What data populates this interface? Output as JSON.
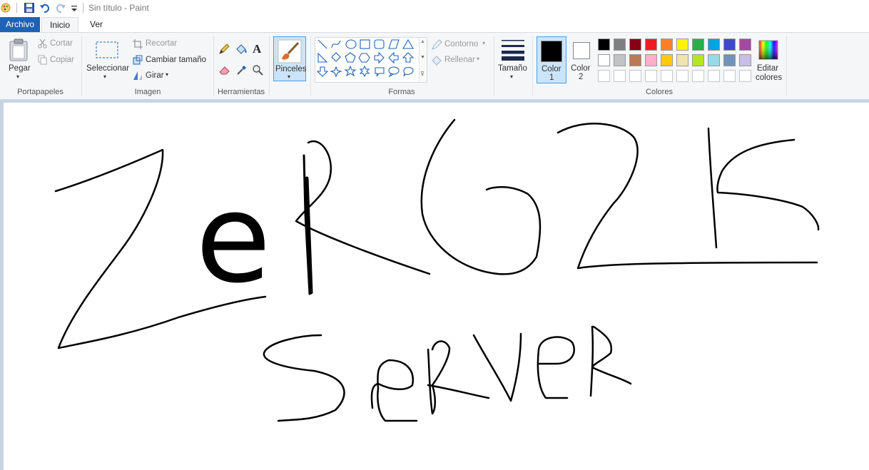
{
  "window": {
    "title": "Sin título - Paint"
  },
  "tabs": [
    {
      "label": "Archivo"
    },
    {
      "label": "Inicio"
    },
    {
      "label": "Ver"
    }
  ],
  "clipboard": {
    "paste": "Pegar",
    "cut": "Cortar",
    "copy": "Copiar",
    "group": "Portapapeles"
  },
  "image": {
    "select": "Seleccionar",
    "crop": "Recortar",
    "resize": "Cambiar tamaño",
    "rotate": "Girar",
    "group": "Imagen"
  },
  "tools": {
    "group": "Herramientas",
    "text_tool_glyph": "A"
  },
  "brushes": {
    "label": "Pinceles"
  },
  "shapes": {
    "outline": "Contorno",
    "fill": "Rellenar",
    "group": "Formas"
  },
  "size": {
    "label": "Tamaño"
  },
  "colors": {
    "color1_line1": "Color",
    "color1_line2": "1",
    "color2_line1": "Color",
    "color2_line2": "2",
    "edit_line1": "Editar",
    "edit_line2": "colores",
    "group": "Colores",
    "color1_value": "#000000",
    "color2_value": "#ffffff",
    "row1": [
      "#000000",
      "#7f7f7f",
      "#880015",
      "#ed1c24",
      "#ff7f27",
      "#fff200",
      "#22b14c",
      "#00a2e8",
      "#3f48cc",
      "#a349a4"
    ],
    "row2": [
      "#ffffff",
      "#c3c3c3",
      "#b97a57",
      "#ffaec9",
      "#ffc90e",
      "#efe4b0",
      "#b5e61d",
      "#99d9ea",
      "#7092be",
      "#c8bfe7"
    ],
    "row3_count": 10
  },
  "drawing": {
    "text_glyph": "e"
  }
}
